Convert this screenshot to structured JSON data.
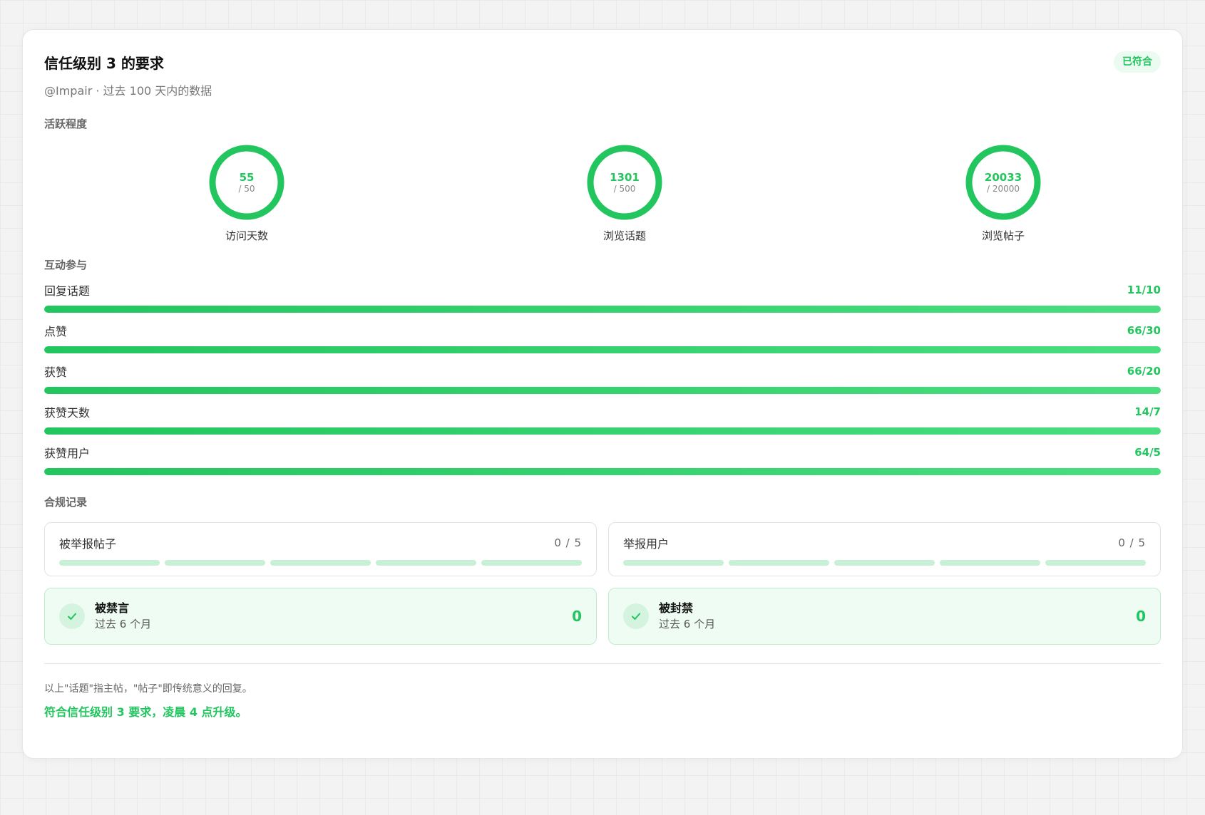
{
  "header": {
    "title": "信任级别 3 的要求",
    "badge": "已符合",
    "subtitle": "@Impair · 过去 100 天内的数据"
  },
  "activity": {
    "label": "活跃程度",
    "rings": [
      {
        "value": "55",
        "target": "/ 50",
        "label": "访问天数",
        "progress": 1.0
      },
      {
        "value": "1301",
        "target": "/ 500",
        "label": "浏览话题",
        "progress": 1.0
      },
      {
        "value": "20033",
        "target": "/ 20000",
        "label": "浏览帖子",
        "progress": 1.0
      }
    ]
  },
  "engagement": {
    "label": "互动参与",
    "bars": [
      {
        "label": "回复话题",
        "value": "11/10",
        "progress": 1.0
      },
      {
        "label": "点赞",
        "value": "66/30",
        "progress": 1.0
      },
      {
        "label": "获赞",
        "value": "66/20",
        "progress": 1.0
      },
      {
        "label": "获赞天数",
        "value": "14/7",
        "progress": 1.0
      },
      {
        "label": "获赞用户",
        "value": "64/5",
        "progress": 1.0
      }
    ]
  },
  "compliance": {
    "label": "合规记录",
    "reports": [
      {
        "label": "被举报帖子",
        "count": "0 / 5",
        "filled": 0,
        "total": 5
      },
      {
        "label": "举报用户",
        "count": "0 / 5",
        "filled": 0,
        "total": 5
      }
    ],
    "statuses": [
      {
        "title": "被禁言",
        "sub": "过去 6 个月",
        "value": "0",
        "icon": "check-icon"
      },
      {
        "title": "被封禁",
        "sub": "过去 6 个月",
        "value": "0",
        "icon": "check-icon"
      }
    ]
  },
  "footer": {
    "note": "以上\"话题\"指主帖，\"帖子\"即传统意义的回复。",
    "result": "符合信任级别 3 要求，凌晨 4 点升级。"
  },
  "colors": {
    "accent": "#22c55e",
    "accent_light": "#4ade80",
    "ring_track": "#dcf5e5"
  }
}
